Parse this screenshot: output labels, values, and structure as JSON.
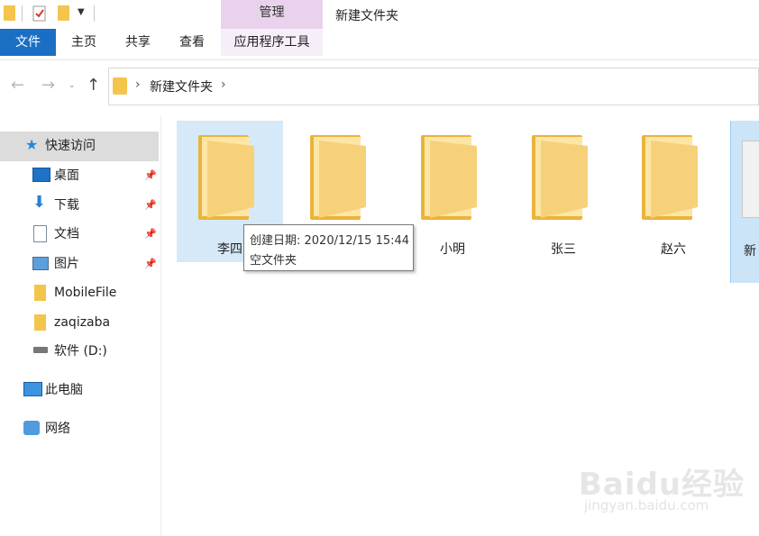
{
  "window": {
    "title": "新建文件夹"
  },
  "ribbon": {
    "context_group": "管理",
    "tabs": [
      {
        "label": "文件",
        "active": true,
        "color": "#1a6fc4"
      },
      {
        "label": "主页"
      },
      {
        "label": "共享"
      },
      {
        "label": "查看"
      },
      {
        "label": "应用程序工具"
      }
    ]
  },
  "nav": {
    "back_icon": "arrow-left-icon",
    "forward_icon": "arrow-right-icon",
    "up_icon": "arrow-up-icon",
    "breadcrumb": [
      "新建文件夹"
    ]
  },
  "sidebar": {
    "items": [
      {
        "label": "快速访问",
        "icon": "star-icon"
      },
      {
        "label": "桌面",
        "icon": "desktop-icon",
        "pinned": true
      },
      {
        "label": "下载",
        "icon": "download-icon",
        "pinned": true
      },
      {
        "label": "文档",
        "icon": "document-icon",
        "pinned": true
      },
      {
        "label": "图片",
        "icon": "picture-icon",
        "pinned": true
      },
      {
        "label": "MobileFile",
        "icon": "folder-icon"
      },
      {
        "label": "zaqizaba",
        "icon": "folder-icon"
      },
      {
        "label": "软件 (D:)",
        "icon": "drive-icon"
      },
      {
        "label": "此电脑",
        "icon": "computer-icon"
      },
      {
        "label": "网络",
        "icon": "network-icon"
      }
    ]
  },
  "content": {
    "folders": [
      {
        "name": "李四",
        "selected": true
      },
      {
        "name": ""
      },
      {
        "name": "小明"
      },
      {
        "name": "张三"
      },
      {
        "name": "赵六"
      },
      {
        "name": "新",
        "selected": true
      }
    ],
    "tooltip": {
      "created": "创建日期: 2020/12/15 15:44",
      "desc": "空文件夹"
    }
  },
  "watermark": {
    "logo": "Baidu经验",
    "url": "jingyan.baidu.com"
  },
  "colors": {
    "accent": "#1a6fc4",
    "folder": "#f4c54d",
    "context_tab": "#e9d3ec",
    "selection": "#d5e9f9"
  }
}
